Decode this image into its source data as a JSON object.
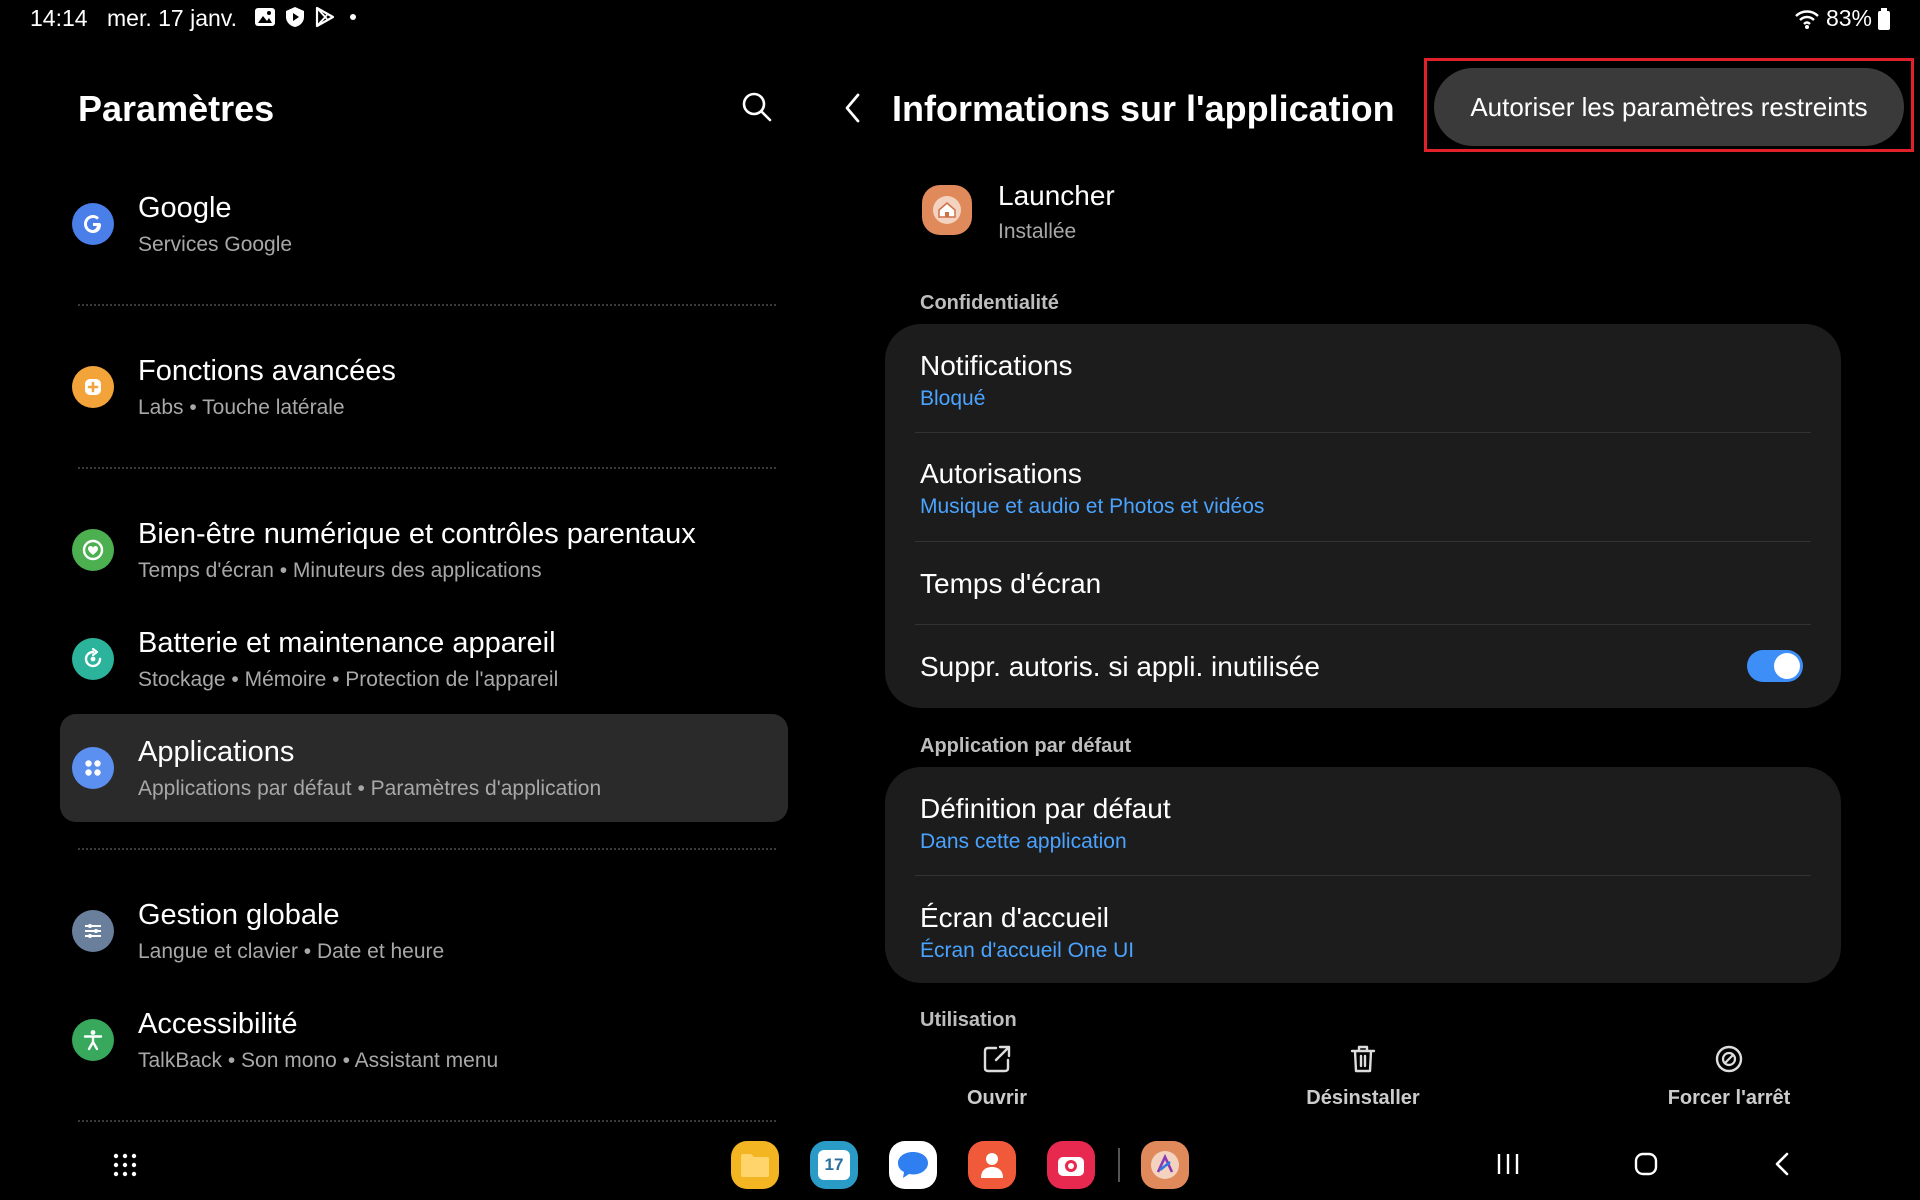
{
  "status_bar": {
    "time": "14:14",
    "date": "mer. 17 janv.",
    "battery": "83%"
  },
  "left_pane": {
    "title": "Paramètres",
    "items": [
      {
        "title": "Google",
        "subtitle": "Services Google",
        "icon": "google-icon",
        "color": "#4a7ee8"
      },
      {
        "title": "Fonctions avancées",
        "subtitle": "Labs  •  Touche latérale",
        "icon": "advanced-features-icon",
        "color": "#f2a33a"
      },
      {
        "title": "Bien-être numérique et contrôles parentaux",
        "subtitle": "Temps d'écran  •  Minuteurs des applications",
        "icon": "wellbeing-icon",
        "color": "#4caf50"
      },
      {
        "title": "Batterie et maintenance appareil",
        "subtitle": "Stockage  •  Mémoire  •  Protection de l'appareil",
        "icon": "battery-care-icon",
        "color": "#2bb39b"
      },
      {
        "title": "Applications",
        "subtitle": "Applications par défaut  •  Paramètres d'application",
        "icon": "apps-icon",
        "color": "#5b8ff0"
      },
      {
        "title": "Gestion globale",
        "subtitle": "Langue et clavier  •  Date et heure",
        "icon": "general-management-icon",
        "color": "#6a7f9c"
      },
      {
        "title": "Accessibilité",
        "subtitle": "TalkBack  •  Son mono  •  Assistant menu",
        "icon": "accessibility-icon",
        "color": "#37a85c"
      }
    ]
  },
  "right_pane": {
    "title": "Informations sur l'application",
    "restricted_button": "Autoriser les paramètres restreints",
    "app": {
      "name": "Launcher",
      "status": "Installée"
    },
    "sections": {
      "privacy": "Confidentialité",
      "default_app": "Application par défaut",
      "usage": "Utilisation"
    },
    "privacy_rows": {
      "notifications": {
        "title": "Notifications",
        "value": "Bloqué"
      },
      "permissions": {
        "title": "Autorisations",
        "value": "Musique et audio et Photos et vidéos"
      },
      "screen_time": {
        "title": "Temps d'écran"
      },
      "remove_permissions": {
        "title": "Suppr. autoris. si appli. inutilisée",
        "toggle_on": true
      }
    },
    "default_rows": {
      "set_default": {
        "title": "Définition par défaut",
        "value": "Dans cette application"
      },
      "home_screen": {
        "title": "Écran d'accueil",
        "value": "Écran d'accueil One UI"
      }
    },
    "actions": {
      "open": "Ouvrir",
      "uninstall": "Désinstaller",
      "force_stop": "Forcer l'arrêt"
    }
  },
  "dock": {
    "calendar_day": "17"
  },
  "colors": {
    "accent_blue": "#4aa3ff",
    "highlight_red": "#e0202a"
  }
}
